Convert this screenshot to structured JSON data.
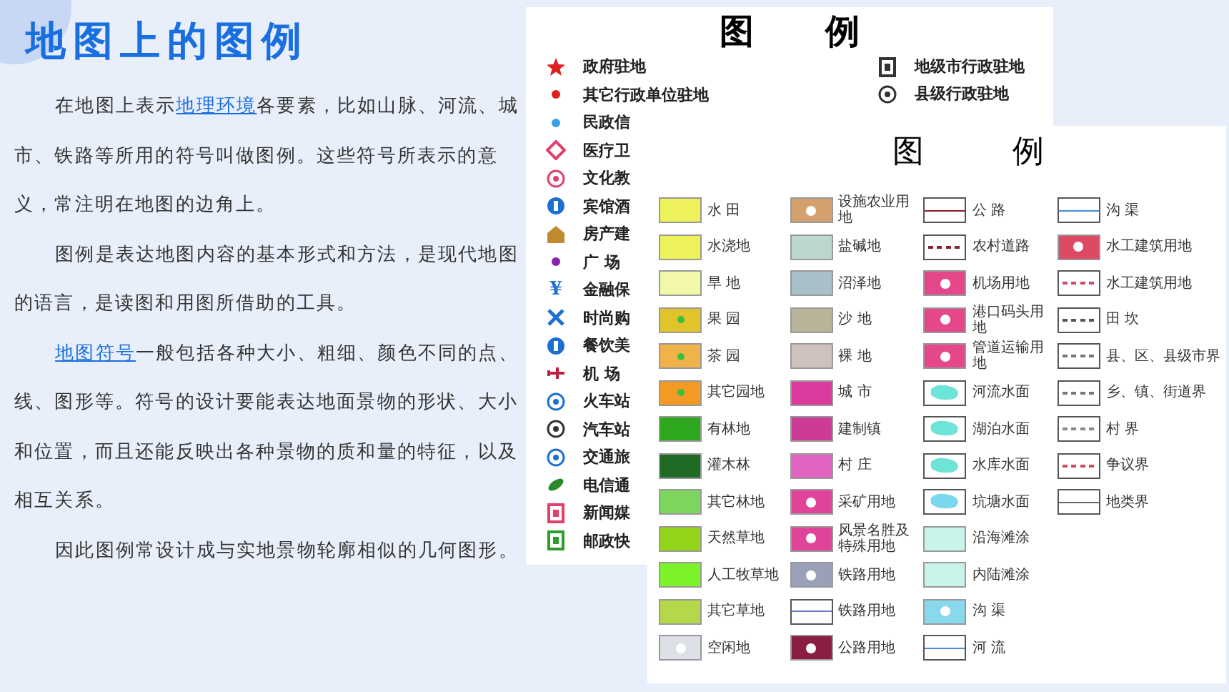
{
  "title": "地图上的图例",
  "paragraphs": [
    {
      "parts": [
        {
          "text": "在地图上表示",
          "link": false
        },
        {
          "text": "地理环境",
          "link": true
        },
        {
          "text": "各要素，比如山脉、河流、城市、铁路等所用的符号叫做图例。这些符号所表示的意义，常注明在地图的边角上。",
          "link": false
        }
      ]
    },
    {
      "parts": [
        {
          "text": "图例是表达地图内容的基本形式和方法，是现代地图的语言，是读图和用图所借助的工具。",
          "link": false
        }
      ]
    },
    {
      "parts": [
        {
          "text": "地图符号",
          "link": true
        },
        {
          "text": "一般包括各种大小、粗细、颜色不同的点、线、图形等。符号的设计要能表达地面景物的形状、大小和位置，而且还能反映出各种景物的质和量的特征，以及相互关系。",
          "link": false
        }
      ]
    },
    {
      "parts": [
        {
          "text": "因此图例常设计成与实地景物轮廓相似的几何图形。",
          "link": false
        }
      ]
    }
  ],
  "back_legend": {
    "title": [
      "图",
      "例"
    ],
    "left_items": [
      {
        "label": "政府驻地",
        "kind": "star",
        "color": "#e02020"
      },
      {
        "label": "其它行政单位驻地",
        "kind": "dot",
        "color": "#e02020"
      },
      {
        "label": "民政信",
        "kind": "dot",
        "color": "#3aa0e8"
      },
      {
        "label": "医疗卫",
        "kind": "diamond",
        "color": "#e0406a"
      },
      {
        "label": "文化教",
        "kind": "ring",
        "color": "#e0406a"
      },
      {
        "label": "宾馆酒",
        "kind": "circle",
        "color": "#1e70d0"
      },
      {
        "label": "房产建",
        "kind": "house",
        "color": "#c08a30"
      },
      {
        "label": "广 场",
        "kind": "dot",
        "color": "#8a20b0"
      },
      {
        "label": "金融保",
        "kind": "glyph",
        "glyph": "¥",
        "color": "#1e70d0"
      },
      {
        "label": "时尚购",
        "kind": "cross",
        "color": "#1e70d0"
      },
      {
        "label": "餐饮美",
        "kind": "circle",
        "color": "#1e70d0"
      },
      {
        "label": "机 场",
        "kind": "plane",
        "color": "#c02040"
      },
      {
        "label": "火车站",
        "kind": "ring",
        "color": "#1e70d0"
      },
      {
        "label": "汽车站",
        "kind": "ring",
        "color": "#333333"
      },
      {
        "label": "交通旅",
        "kind": "ring",
        "color": "#1e70d0"
      },
      {
        "label": "电信通",
        "kind": "leaf",
        "color": "#2a8a2a"
      },
      {
        "label": "新闻媒",
        "kind": "square",
        "color": "#e0406a"
      },
      {
        "label": "邮政快",
        "kind": "square",
        "color": "#2aa02a"
      }
    ],
    "right_items": [
      {
        "label": "地级市行政驻地",
        "kind": "square",
        "color": "#333333"
      },
      {
        "label": "县级行政驻地",
        "kind": "ring",
        "color": "#333333"
      }
    ]
  },
  "front_legend": {
    "title": [
      "图",
      "例"
    ],
    "columns": [
      {
        "items": [
          {
            "label": "水 田",
            "kind": "fill",
            "color": "#eef25a"
          },
          {
            "label": "水浇地",
            "kind": "fill",
            "color": "#eef25a"
          },
          {
            "label": "旱 地",
            "kind": "fill",
            "color": "#f3f7a8"
          },
          {
            "label": "果 园",
            "kind": "fill-dot",
            "color": "#e0c42a"
          },
          {
            "label": "茶 园",
            "kind": "fill-dot",
            "color": "#f2b24a"
          },
          {
            "label": "其它园地",
            "kind": "fill-dot",
            "color": "#f29a24"
          },
          {
            "label": "有林地",
            "kind": "fill",
            "color": "#2ea81e"
          },
          {
            "label": "灌木林",
            "kind": "fill",
            "color": "#1f6a24"
          },
          {
            "label": "其它林地",
            "kind": "fill",
            "color": "#7ed65e"
          },
          {
            "label": "天然草地",
            "kind": "fill",
            "color": "#92d41a"
          },
          {
            "label": "人工牧草地",
            "kind": "fill",
            "color": "#7cf22a"
          },
          {
            "label": "其它草地",
            "kind": "fill",
            "color": "#b4d84a"
          },
          {
            "label": "空闲地",
            "kind": "fill-symbol",
            "color": "#dde0e6"
          }
        ]
      },
      {
        "items": [
          {
            "label": "设施农业用地",
            "kind": "fill-symbol",
            "color": "#d4a06e"
          },
          {
            "label": "盐碱地",
            "kind": "fill",
            "color": "#bcd6d0"
          },
          {
            "label": "沼泽地",
            "kind": "fill",
            "color": "#a8c0c8"
          },
          {
            "label": "沙 地",
            "kind": "fill",
            "color": "#b8b49a"
          },
          {
            "label": "裸 地",
            "kind": "fill",
            "color": "#cfc2bc"
          },
          {
            "label": "城 市",
            "kind": "fill",
            "color": "#dc3a9e"
          },
          {
            "label": "建制镇",
            "kind": "fill",
            "color": "#cc3c96"
          },
          {
            "label": "村 庄",
            "kind": "fill",
            "color": "#e064c0"
          },
          {
            "label": "采矿用地",
            "kind": "fill-symbol",
            "color": "#e0449a"
          },
          {
            "label": "风景名胜及特殊用地",
            "kind": "fill-symbol",
            "color": "#e0449a"
          },
          {
            "label": "铁路用地",
            "kind": "fill-symbol",
            "color": "#9aa0b8"
          },
          {
            "label": "铁路用地",
            "kind": "line",
            "color": "#6a7ac0"
          },
          {
            "label": "公路用地",
            "kind": "fill-symbol",
            "color": "#8a1e40"
          }
        ]
      },
      {
        "items": [
          {
            "label": "公 路",
            "kind": "line",
            "color": "#8a1e2e"
          },
          {
            "label": "农村道路",
            "kind": "dashed",
            "color": "#8a1e2e"
          },
          {
            "label": "机场用地",
            "kind": "fill-symbol",
            "color": "#e4488a"
          },
          {
            "label": "港口码头用地",
            "kind": "fill-symbol",
            "color": "#e4488a"
          },
          {
            "label": "管道运输用地",
            "kind": "fill-symbol",
            "color": "#e4488a"
          },
          {
            "label": "河流水面",
            "kind": "water",
            "color": "#6ee4d8"
          },
          {
            "label": "湖泊水面",
            "kind": "water",
            "color": "#6ee4d8"
          },
          {
            "label": "水库水面",
            "kind": "water",
            "color": "#6ee4d8"
          },
          {
            "label": "坑塘水面",
            "kind": "water",
            "color": "#7ad8ee"
          },
          {
            "label": "沿海滩涂",
            "kind": "fill",
            "color": "#c8f4ec"
          },
          {
            "label": "内陆滩涂",
            "kind": "fill",
            "color": "#c8f4ec"
          },
          {
            "label": "沟 渠",
            "kind": "fill-symbol",
            "color": "#88d8ee"
          },
          {
            "label": "河 流",
            "kind": "line",
            "color": "#4a8ad8"
          }
        ]
      },
      {
        "items": [
          {
            "label": "沟 渠",
            "kind": "line",
            "color": "#4a8ad8"
          },
          {
            "label": "水工建筑用地",
            "kind": "fill-symbol",
            "color": "#dc4a66"
          },
          {
            "label": "水工建筑用地",
            "kind": "dashed",
            "color": "#d04a6a"
          },
          {
            "label": "田 坎",
            "kind": "dashed",
            "color": "#555555"
          },
          {
            "label": "县、区、县级市界",
            "kind": "dashed",
            "color": "#777777"
          },
          {
            "label": "乡、镇、街道界",
            "kind": "dashed",
            "color": "#777777"
          },
          {
            "label": "村 界",
            "kind": "dashed",
            "color": "#888888"
          },
          {
            "label": "争议界",
            "kind": "dashed",
            "color": "#d04a5a"
          },
          {
            "label": "地类界",
            "kind": "line",
            "color": "#666666"
          }
        ]
      }
    ]
  }
}
